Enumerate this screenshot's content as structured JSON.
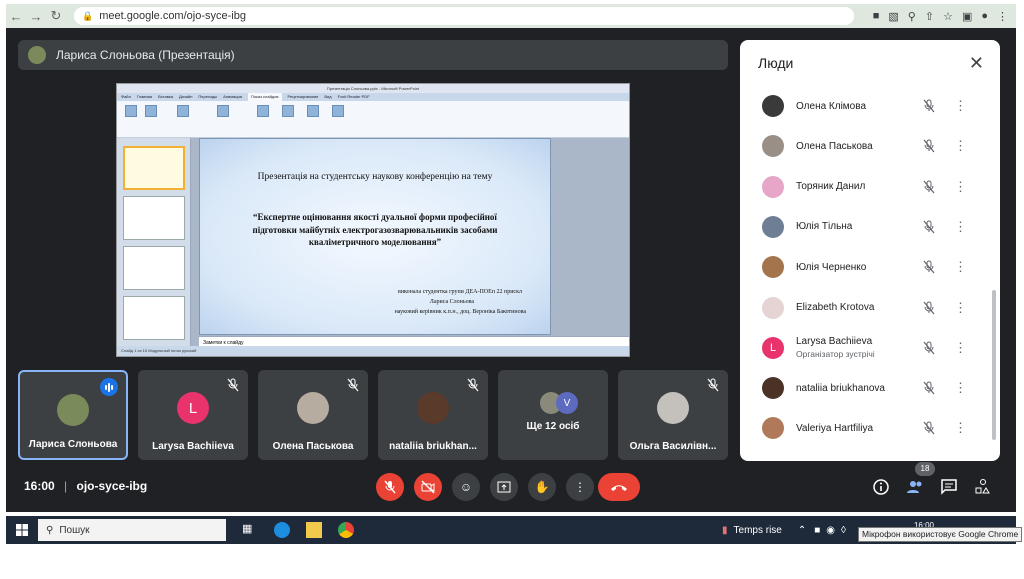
{
  "browser": {
    "url": "meet.google.com/ojo-syce-ibg",
    "back_icon": "arrow-left-icon",
    "forward_icon": "arrow-right-icon",
    "reload_icon": "reload-icon"
  },
  "presenter": {
    "label": "Лариса Слоньова (Презентація)"
  },
  "presentation": {
    "window_title": "Презентація Слоньова.pptx - Microsoft PowerPoint",
    "tabs": [
      "Файл",
      "Главная",
      "Вставка",
      "Дизайн",
      "Переходы",
      "Анимация",
      "Показ слайдов",
      "Рецензирование",
      "Вид",
      "Foxit Reader PDF"
    ],
    "slide_intro": "Презентація  на студентську наукову конференцію на тему",
    "slide_title": "“Експертне оцінювання якості дуальної форми професійної підготовки майбутніх електрогазозварювальників засобами кваліметричного моделювання”",
    "author_line1": "виконала студентка групи ДЕА-ПОЕп  22 прискл",
    "author_line2": "Лариса Слоньова",
    "author_line3": "науковий керівник  к.п.н., доц. Вероніка Бакотинова",
    "notes_placeholder": "Заметки к слайду",
    "status_text": "Слайд 1 из 15   Модульный поток   русский"
  },
  "people_panel": {
    "title": "Люди",
    "people": [
      {
        "name": "Олена Клімова",
        "subtitle": "",
        "avatar": "#3a3a3a"
      },
      {
        "name": "Олена Паськова",
        "subtitle": "",
        "avatar": "#9a8f86"
      },
      {
        "name": "Торяник Данил",
        "subtitle": "",
        "avatar": "#e7a6c8"
      },
      {
        "name": "Юлія Тільна",
        "subtitle": "",
        "avatar": "#6e7f95"
      },
      {
        "name": "Юлія Черненко",
        "subtitle": "",
        "avatar": "#a4744d"
      },
      {
        "name": "Elizabeth Krotova",
        "subtitle": "",
        "avatar": "#e6d3d3"
      },
      {
        "name": "Larysa Bachiieva",
        "subtitle": "Організатор зустрічі",
        "avatar": "#e8336d",
        "initial": "L"
      },
      {
        "name": "nataliia briukhanova",
        "subtitle": "",
        "avatar": "#4a3226"
      },
      {
        "name": "Valeriya Hartfiliya",
        "subtitle": "",
        "avatar": "#b07a5a"
      }
    ]
  },
  "tiles": [
    {
      "name": "Лариса Слоньова",
      "avatar": "#7a8a5a"
    },
    {
      "name": "Larysa Bachiieva",
      "avatar": "#e8336d",
      "initial": "L"
    },
    {
      "name": "Олена Паськова",
      "avatar": "#b6aca0"
    },
    {
      "name": "nataliia briukhan...",
      "avatar": "#5a3a2a"
    },
    {
      "name": "Ще 12 осіб",
      "avatar": "#8a8a7a",
      "initial": "V"
    },
    {
      "name": "Ольга Василівн...",
      "avatar": "#c4c0bc"
    }
  ],
  "bottom_bar": {
    "time": "16:00",
    "separator": "|",
    "meeting_code": "ojo-syce-ibg",
    "participant_count": "18"
  },
  "taskbar": {
    "search_placeholder": "Пошук",
    "weather": "Temps rise",
    "clock": "16:00",
    "tooltip": "Мікрофон використовує Google Chrome"
  },
  "colors": {
    "meet_bg": "#202124",
    "tile_bg": "#3c4043",
    "end_call": "#ea4335",
    "accent": "#1a73e8"
  }
}
